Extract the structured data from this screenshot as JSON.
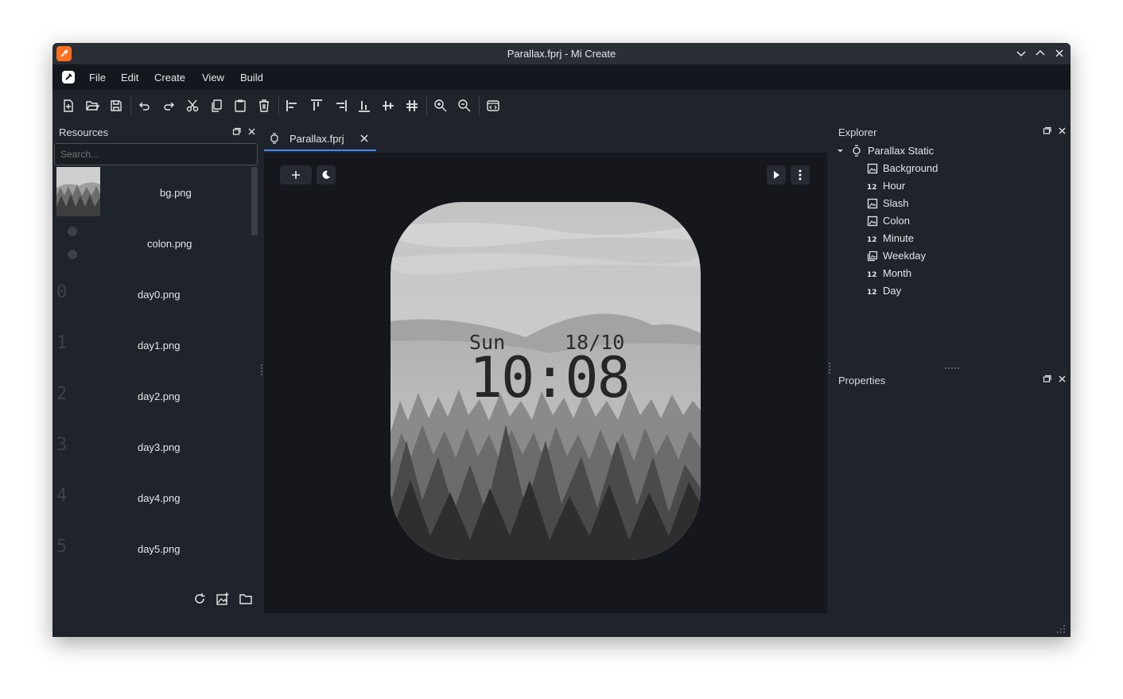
{
  "window": {
    "title": "Parallax.fprj - Mi Create"
  },
  "menu": [
    "File",
    "Edit",
    "Create",
    "View",
    "Build"
  ],
  "resources": {
    "title": "Resources",
    "search_placeholder": "Search...",
    "items": [
      {
        "label": "bg.png",
        "digit": ""
      },
      {
        "label": "colon.png",
        "digit": ""
      },
      {
        "label": "day0.png",
        "digit": "0"
      },
      {
        "label": "day1.png",
        "digit": "1"
      },
      {
        "label": "day2.png",
        "digit": "2"
      },
      {
        "label": "day3.png",
        "digit": "3"
      },
      {
        "label": "day4.png",
        "digit": "4"
      },
      {
        "label": "day5.png",
        "digit": "5"
      }
    ]
  },
  "editor": {
    "tab_label": "Parallax.fprj",
    "watch": {
      "weekday": "Sun",
      "date": "18/10",
      "time": "10:08"
    }
  },
  "explorer": {
    "title": "Explorer",
    "root": "Parallax Static",
    "items": [
      {
        "label": "Background",
        "icon": "image-icon"
      },
      {
        "label": "Hour",
        "icon": "number-icon"
      },
      {
        "label": "Slash",
        "icon": "image-icon"
      },
      {
        "label": "Colon",
        "icon": "image-icon"
      },
      {
        "label": "Minute",
        "icon": "number-icon"
      },
      {
        "label": "Weekday",
        "icon": "image-list-icon"
      },
      {
        "label": "Month",
        "icon": "number-icon"
      },
      {
        "label": "Day",
        "icon": "number-icon"
      }
    ]
  },
  "properties": {
    "title": "Properties"
  },
  "colors": {
    "accent": "#3d8cff",
    "app_icon": "#ff6f1f",
    "bg": "#1f232b",
    "canvas": "#15171c"
  }
}
